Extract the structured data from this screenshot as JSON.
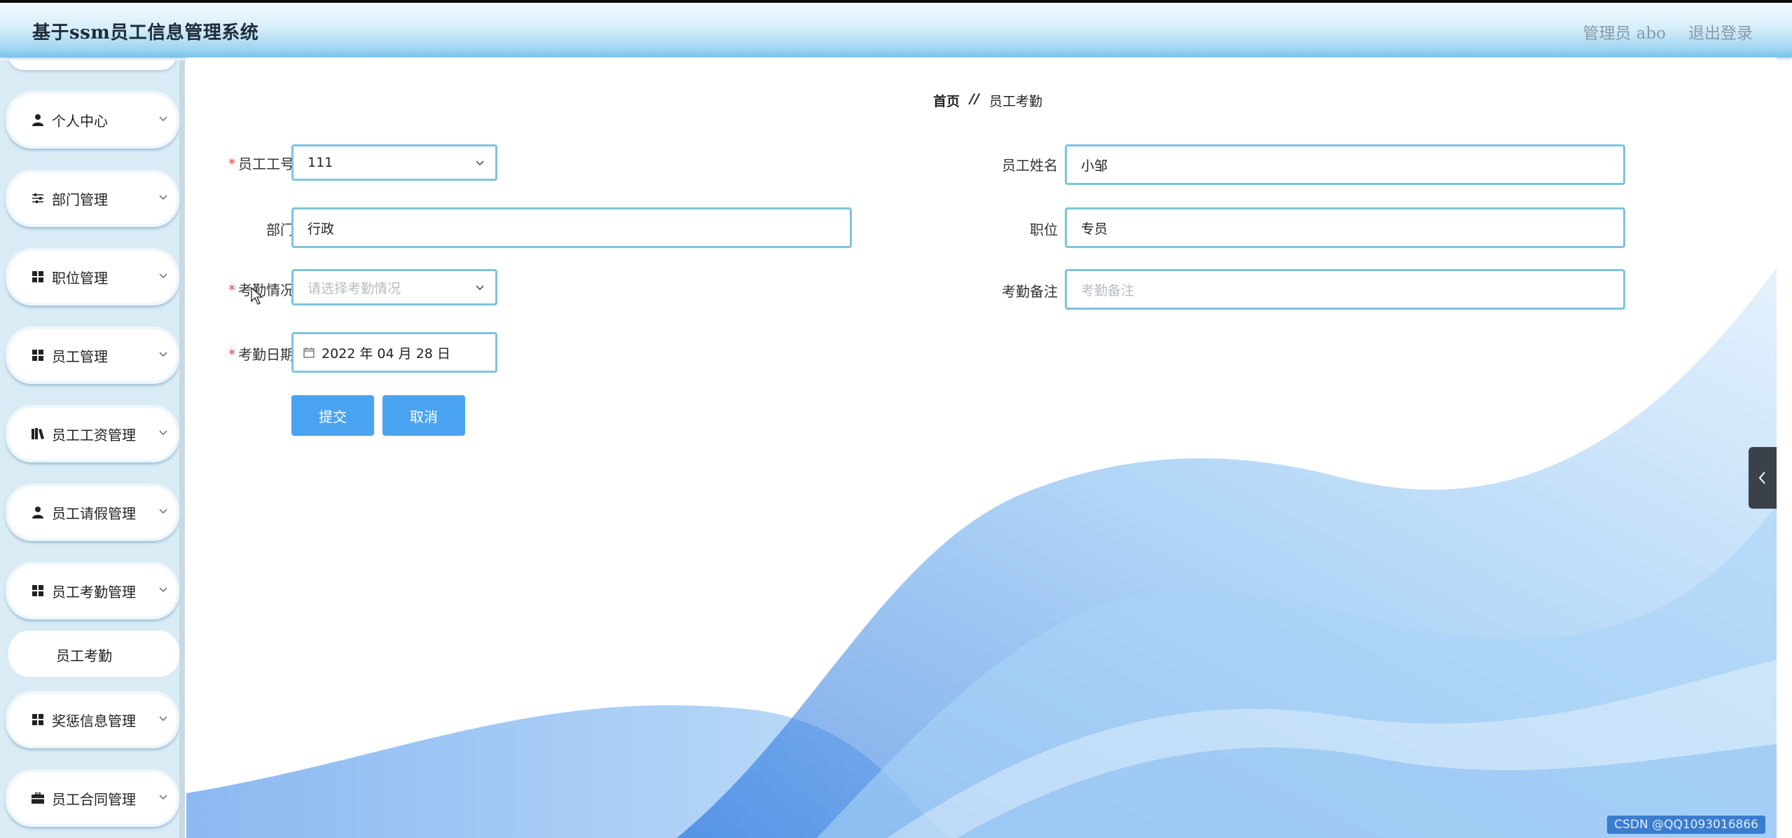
{
  "header": {
    "title": "基于ssm员工信息管理系统",
    "user_label": "管理员 abo",
    "logout_label": "退出登录"
  },
  "sidebar": {
    "items": [
      {
        "label": "个人中心",
        "icon": "user-icon"
      },
      {
        "label": "部门管理",
        "icon": "sliders-icon"
      },
      {
        "label": "职位管理",
        "icon": "grid-icon"
      },
      {
        "label": "员工管理",
        "icon": "grid-icon"
      },
      {
        "label": "员工工资管理",
        "icon": "books-icon"
      },
      {
        "label": "员工请假管理",
        "icon": "user-icon"
      },
      {
        "label": "员工考勤管理",
        "icon": "grid-icon"
      },
      {
        "label": "奖惩信息管理",
        "icon": "grid-icon"
      },
      {
        "label": "员工合同管理",
        "icon": "briefcase-icon"
      }
    ],
    "active_sub": "员工考勤"
  },
  "breadcrumb": {
    "home": "首页",
    "separator": "//",
    "current": "员工考勤"
  },
  "form": {
    "employee_no": {
      "label": "员工工号",
      "value": "111",
      "required": true
    },
    "employee_name": {
      "label": "员工姓名",
      "value": "小邹"
    },
    "department": {
      "label": "部门",
      "value": "行政"
    },
    "position": {
      "label": "职位",
      "value": "专员"
    },
    "attendance_status": {
      "label": "考勤情况",
      "placeholder": "请选择考勤情况",
      "required": true
    },
    "attendance_note": {
      "label": "考勤备注",
      "placeholder": "考勤备注"
    },
    "attendance_date": {
      "label": "考勤日期",
      "value": "2022 年 04 月 28 日",
      "required": true
    }
  },
  "buttons": {
    "submit": "提交",
    "cancel": "取消"
  },
  "required_mark": "*",
  "watermark": "CSDN @QQ1093016866",
  "colors": {
    "accent": "#4aa3f1",
    "input_border": "#7cc4de",
    "sidebar_bg": "#d9ebf5",
    "required": "#e8464a"
  }
}
